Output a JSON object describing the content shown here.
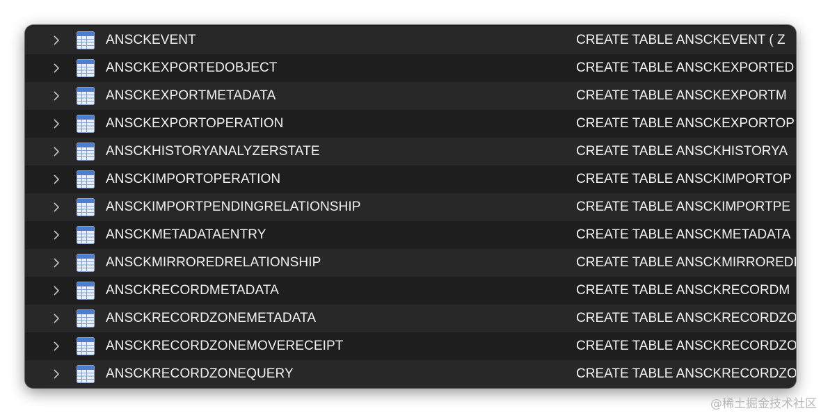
{
  "rows": [
    {
      "name": "ANSCKEVENT",
      "schema": "CREATE TABLE ANSCKEVENT ( Z"
    },
    {
      "name": "ANSCKEXPORTEDOBJECT",
      "schema": "CREATE TABLE ANSCKEXPORTED"
    },
    {
      "name": "ANSCKEXPORTMETADATA",
      "schema": "CREATE TABLE ANSCKEXPORTM"
    },
    {
      "name": "ANSCKEXPORTOPERATION",
      "schema": "CREATE TABLE ANSCKEXPORTOP"
    },
    {
      "name": "ANSCKHISTORYANALYZERSTATE",
      "schema": "CREATE TABLE ANSCKHISTORYA"
    },
    {
      "name": "ANSCKIMPORTOPERATION",
      "schema": "CREATE TABLE ANSCKIMPORTOP"
    },
    {
      "name": "ANSCKIMPORTPENDINGRELATIONSHIP",
      "schema": "CREATE TABLE ANSCKIMPORTPE"
    },
    {
      "name": "ANSCKMETADATAENTRY",
      "schema": "CREATE TABLE ANSCKMETADATA"
    },
    {
      "name": "ANSCKMIRROREDRELATIONSHIP",
      "schema": "CREATE TABLE ANSCKMIRROREDI"
    },
    {
      "name": "ANSCKRECORDMETADATA",
      "schema": "CREATE TABLE ANSCKRECORDM"
    },
    {
      "name": "ANSCKRECORDZONEMETADATA",
      "schema": "CREATE TABLE ANSCKRECORDZO"
    },
    {
      "name": "ANSCKRECORDZONEMOVERECEIPT",
      "schema": "CREATE TABLE ANSCKRECORDZO"
    },
    {
      "name": "ANSCKRECORDZONEQUERY",
      "schema": "CREATE TABLE ANSCKRECORDZO"
    }
  ],
  "icons": {
    "row_expand": "chevron-right-icon",
    "row_type": "table-icon"
  },
  "colors": {
    "row_odd": "#282828",
    "row_even": "#1e1e1e",
    "text": "#f2f2f2",
    "icon_blue": "#4a7fd0"
  },
  "watermark": "@稀土掘金技术社区"
}
